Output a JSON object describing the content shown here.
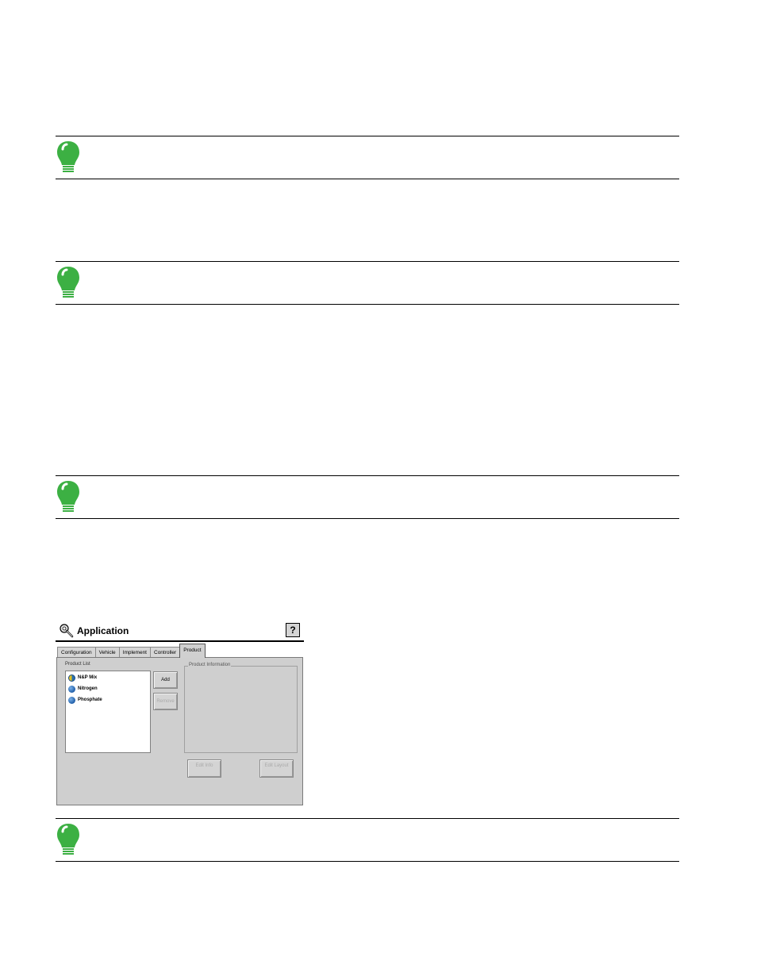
{
  "window": {
    "title": "Application",
    "help_label": "?",
    "icon": "wrench-icon"
  },
  "tabs": [
    {
      "label": "Configuration"
    },
    {
      "label": "Vehicle"
    },
    {
      "label": "Implement"
    },
    {
      "label": "Controller"
    },
    {
      "label": "Product"
    }
  ],
  "active_tab": "Product",
  "product_list": {
    "label": "Product List",
    "items": [
      {
        "name": "N&P Mix",
        "icon": "mix-product-icon"
      },
      {
        "name": "Nitrogen",
        "icon": "product-icon"
      },
      {
        "name": "Phosphate",
        "icon": "product-icon"
      }
    ]
  },
  "buttons": {
    "add": "Add",
    "remove": "Remove",
    "edit_info": "Edit Info",
    "edit_layout": "Edit Layout"
  },
  "product_info": {
    "label": "Product Information"
  },
  "colors": {
    "note_icon": "#3cb043",
    "panel": "#cfcfcf"
  }
}
